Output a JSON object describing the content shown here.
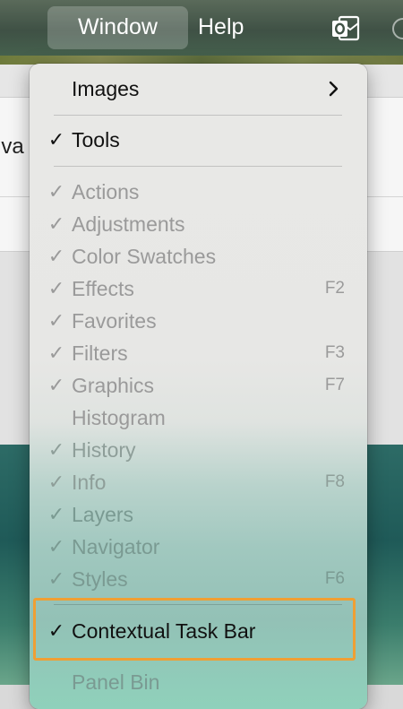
{
  "menubar": {
    "items": [
      {
        "label": "Window",
        "active": true
      },
      {
        "label": "Help",
        "active": false
      }
    ],
    "status_icons": [
      "outlook-icon",
      "partial-status-icon"
    ]
  },
  "background": {
    "visible_text_fragment": "lva"
  },
  "menu": {
    "title": "Window",
    "items": [
      {
        "label": "Images",
        "checked": false,
        "enabled": true,
        "submenu": true
      },
      {
        "label": "Tools",
        "checked": true,
        "enabled": true
      },
      {
        "label": "Actions",
        "checked": true,
        "enabled": false
      },
      {
        "label": "Adjustments",
        "checked": true,
        "enabled": false
      },
      {
        "label": "Color Swatches",
        "checked": true,
        "enabled": false
      },
      {
        "label": "Effects",
        "checked": true,
        "enabled": false,
        "shortcut": "F2"
      },
      {
        "label": "Favorites",
        "checked": true,
        "enabled": false
      },
      {
        "label": "Filters",
        "checked": true,
        "enabled": false,
        "shortcut": "F3"
      },
      {
        "label": "Graphics",
        "checked": true,
        "enabled": false,
        "shortcut": "F7"
      },
      {
        "label": "Histogram",
        "checked": false,
        "enabled": false
      },
      {
        "label": "History",
        "checked": true,
        "enabled": false
      },
      {
        "label": "Info",
        "checked": true,
        "enabled": false,
        "shortcut": "F8"
      },
      {
        "label": "Layers",
        "checked": true,
        "enabled": false
      },
      {
        "label": "Navigator",
        "checked": true,
        "enabled": false
      },
      {
        "label": "Styles",
        "checked": true,
        "enabled": false,
        "shortcut": "F6"
      },
      {
        "label": "Contextual Task Bar",
        "checked": true,
        "enabled": true,
        "highlighted": true
      },
      {
        "label": "Panel Bin",
        "checked": false,
        "enabled": false
      }
    ],
    "check_glyph": "✓"
  },
  "colors": {
    "highlight_border": "#ef9f34",
    "disabled_text": "#9a9a9a",
    "enabled_text": "#111111"
  }
}
